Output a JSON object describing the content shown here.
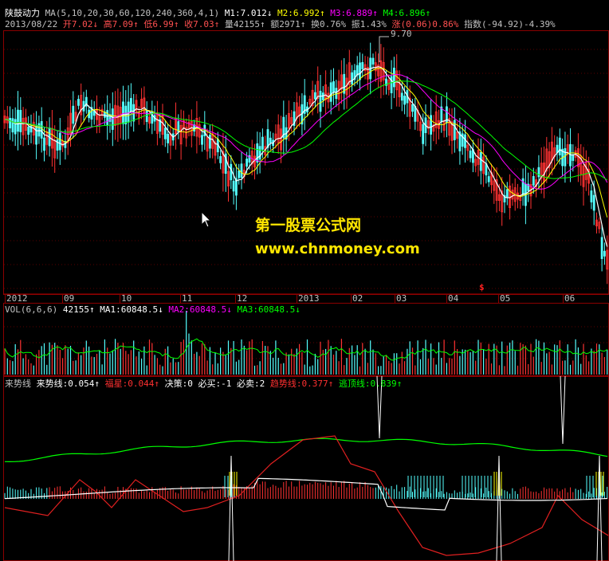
{
  "colors": {
    "background": "#000000",
    "frame": "#a00000",
    "grid": "#5a0000",
    "up": "#ff3232",
    "down": "#54ffff",
    "ma1": "#ffffff",
    "ma2": "#ffff00",
    "ma3": "#ff00ff",
    "ma4": "#00ff00",
    "ma5": "#e0e0e0",
    "text_up": "#ff5050",
    "text_down": "#00ff00",
    "label": "#c0c0c0",
    "watermark": "#ffe600"
  },
  "header": {
    "title": "陕鼓动力",
    "ma_params": "MA(5,10,20,30,60,120,240,360,4,1)",
    "m1": "M1:7.012↓",
    "m2": "M2:6.992↑",
    "m3": "M3:6.889↑",
    "m4": "M4:6.896↑"
  },
  "quote": {
    "date": "2013/08/22",
    "open": "开7.02↓",
    "high": "高7.09↑",
    "low": "低6.99↑",
    "close": "收7.03↑",
    "volume": "量42155↑",
    "amount": "额2971↑",
    "turnover": "换0.76%",
    "amplitude": "振1.43%",
    "change": "涨(0.06)0.86%",
    "index": "指数(-94.92)-4.39%"
  },
  "price_pane": {
    "peak_label": "9.70"
  },
  "date_axis": {
    "labels": [
      "2012",
      "09",
      "10",
      "11",
      "12",
      "2013",
      "02",
      "03",
      "04",
      "05",
      "06"
    ],
    "marker": "$"
  },
  "volume_pane": {
    "title": "VOL(6,6,6)",
    "value": "42155↑",
    "ma1": "MA1:60848.5↓",
    "ma2": "MA2:60848.5↓",
    "ma3": "MA3:60848.5↓"
  },
  "indicator_pane": {
    "title": "来势线",
    "laishi": "来势线:0.054↑",
    "fuxing": "福星:0.044↑",
    "juece": "决策:0",
    "bimai": "必买:-1",
    "bimai2": "必卖:2",
    "qushi": "趋势线:0.377↑",
    "taoding": "逃顶线:0.839↑"
  },
  "watermark": {
    "line1": "第一股票公式网",
    "line2": "www.chnmoney.com"
  }
}
